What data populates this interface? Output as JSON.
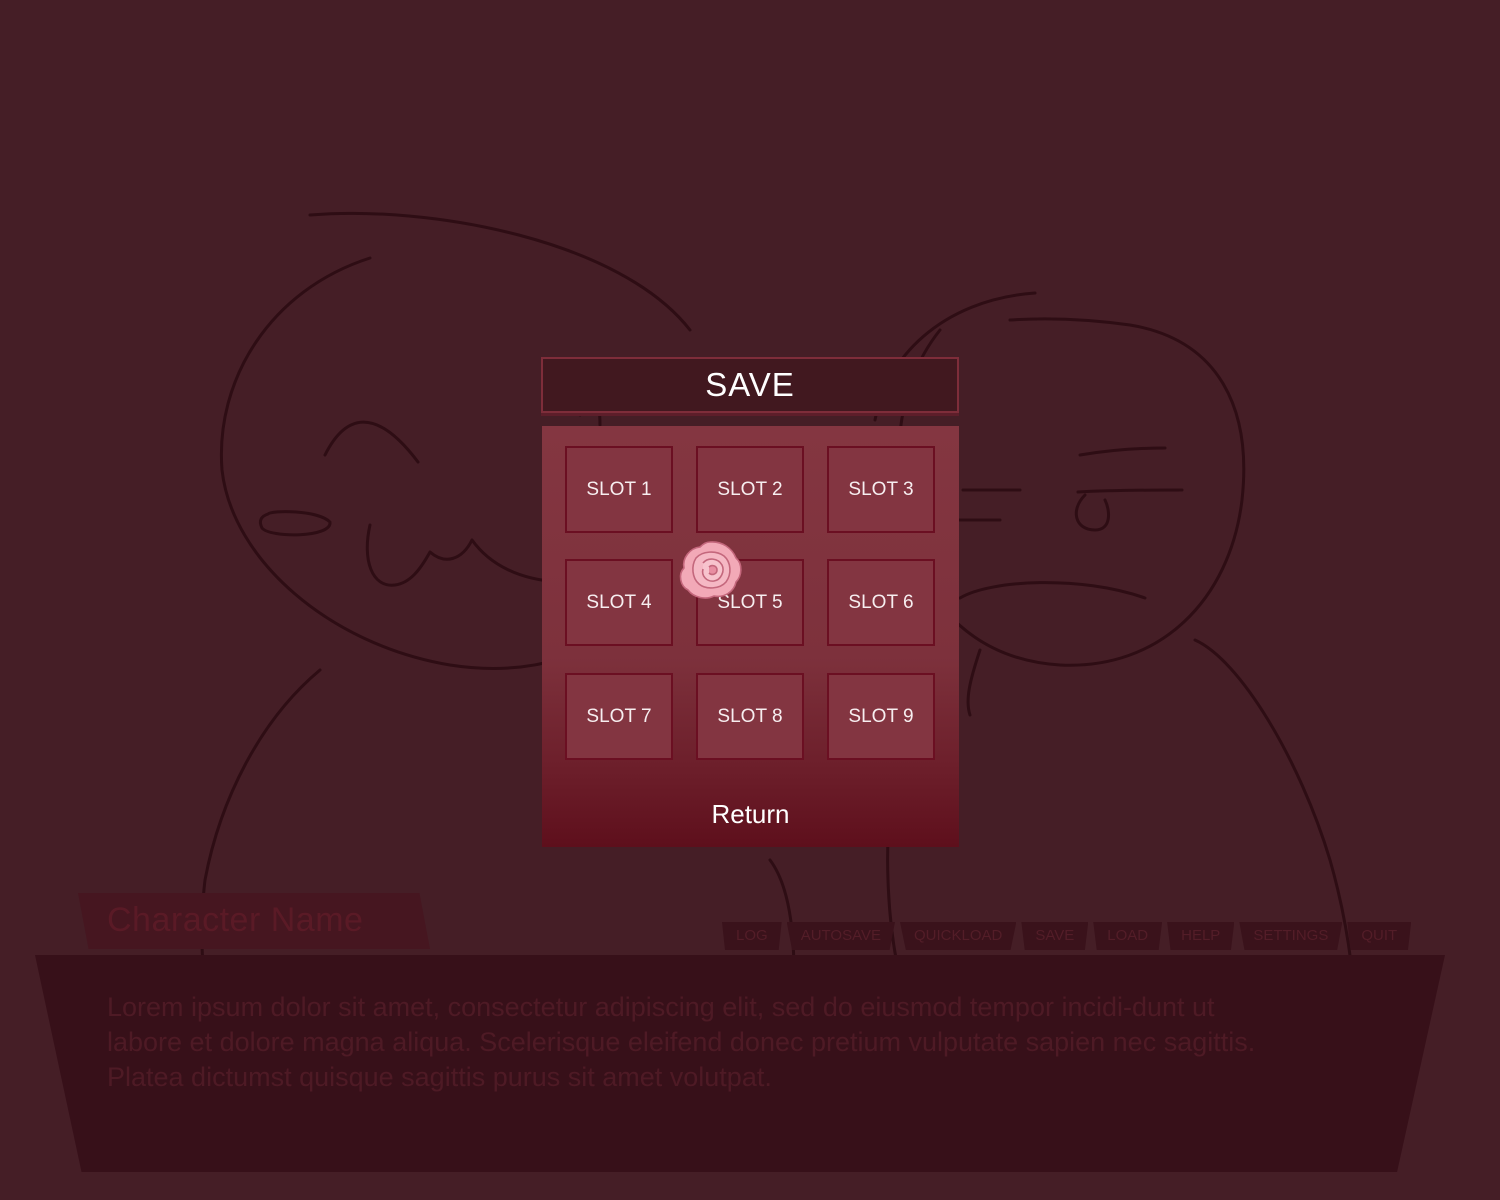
{
  "save_menu": {
    "title": "SAVE",
    "slots": [
      "SLOT 1",
      "SLOT 2",
      "SLOT 3",
      "SLOT 4",
      "SLOT 5",
      "SLOT 6",
      "SLOT 7",
      "SLOT 8",
      "SLOT 9"
    ],
    "return_label": "Return",
    "cursor_icon": "rose-icon"
  },
  "dialogue": {
    "character_name": "Character Name",
    "text": "Lorem ipsum dolor sit amet, consectetur adipiscing elit, sed do eiusmod tempor incidi-dunt ut labore et dolore magna aliqua. Scelerisque eleifend donec pretium vulputate sapien nec sagittis. Platea dictumst quisque sagittis purus sit amet volutpat."
  },
  "quick_menu": {
    "items": [
      "LOG",
      "AUTOSAVE",
      "QUICKLOAD",
      "SAVE",
      "LOAD",
      "HELP",
      "SETTINGS",
      "QUIT"
    ]
  },
  "colors": {
    "background": "#451e26",
    "panel": "#843641",
    "slot_border": "#6b0f22",
    "text": "#ffffff"
  }
}
